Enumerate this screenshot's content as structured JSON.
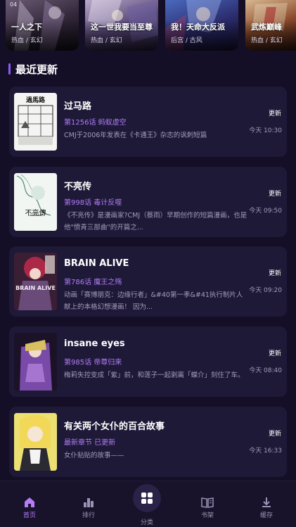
{
  "recommend": {
    "page_indicator": "04",
    "items": [
      {
        "title": "一人之下",
        "tags": "热血 / 玄幻",
        "color": "#3a2d45"
      },
      {
        "title": "这一世我要当至尊",
        "tags": "热血 / 玄幻",
        "color": "#4a3a66"
      },
      {
        "title": "我！天命大反派",
        "tags": "后宫 / 古风",
        "color": "#2b3a6a"
      },
      {
        "title": "武炼巅峰",
        "tags": "热血 / 玄幻",
        "color": "#6a3a2a"
      }
    ]
  },
  "section": {
    "title": "最近更新"
  },
  "updates": [
    {
      "name": "过马路",
      "chapter": "第1256话 蚂蚁虚空",
      "desc": "CMJ于2006年发表在《卡通王》杂志的讽刺短篇",
      "badge": "更新",
      "time": "今天 10:30",
      "cover_title": "過馬路"
    },
    {
      "name": "不亮传",
      "chapter": "第998话 毒计反噬",
      "desc": "《不亮传》是漫画家?CMJ（蔡雨）早期创作的短篇漫画，也是他\"愤青三部曲\"的开篇之...",
      "badge": "更新",
      "time": "今天 09:50",
      "cover_title": "不亮傳"
    },
    {
      "name": "BRAIN ALIVE",
      "chapter": "第786话 魔王之殇",
      "desc": "动画「赛博朋克：边缘行者」&#40第一季&#41执行制片人献上的本格幻想漫画！ 因为...",
      "badge": "更新",
      "time": "今天 09:20",
      "cover_title": "BRAIN ALIVE"
    },
    {
      "name": "insane eyes",
      "chapter": "第985话 帝尊归来",
      "desc": "梅莉失控变成「紫」前，和莲子一起剥离「蝶介」刻住了车。",
      "badge": "更新",
      "time": "今天 08:40",
      "cover_title": ""
    },
    {
      "name": "有关两个女仆的百合故事",
      "chapter": "最新章节 已更新",
      "desc": "女仆贴贴的故事——",
      "badge": "更新",
      "time": "今天 16:33",
      "cover_title": ""
    }
  ],
  "nav": {
    "home": "首页",
    "rank": "排行",
    "category": "分类",
    "shelf": "书架",
    "cache": "缓存"
  },
  "colors": {
    "background": "#140f26",
    "card": "#1f1938",
    "accent": "#8b5cf6",
    "chapter": "#b07cf6"
  }
}
